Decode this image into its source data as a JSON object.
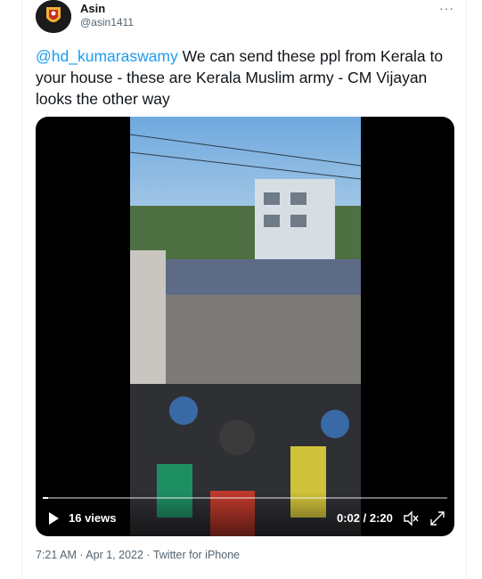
{
  "user": {
    "name": "Asin",
    "handle": "@asin1411"
  },
  "more_label": "···",
  "tweet": {
    "mention": "@hd_kumaraswamy",
    "text_rest": " We can send these ppl from Kerala to your house - these are Kerala Muslim army - CM Vijayan looks the other way"
  },
  "video": {
    "views": "16 views",
    "time": "0:02 / 2:20",
    "progress": 0.014
  },
  "meta": {
    "time": "7:21 AM",
    "sep1": " · ",
    "date": "Apr 1, 2022",
    "sep2": " · ",
    "source": "Twitter for iPhone"
  },
  "colors": {
    "accent": "#1d9bf0",
    "text": "#0f1419",
    "secondary": "#536471"
  },
  "icons": [
    "more-icon",
    "play-icon",
    "mute-icon",
    "fullscreen-icon"
  ]
}
